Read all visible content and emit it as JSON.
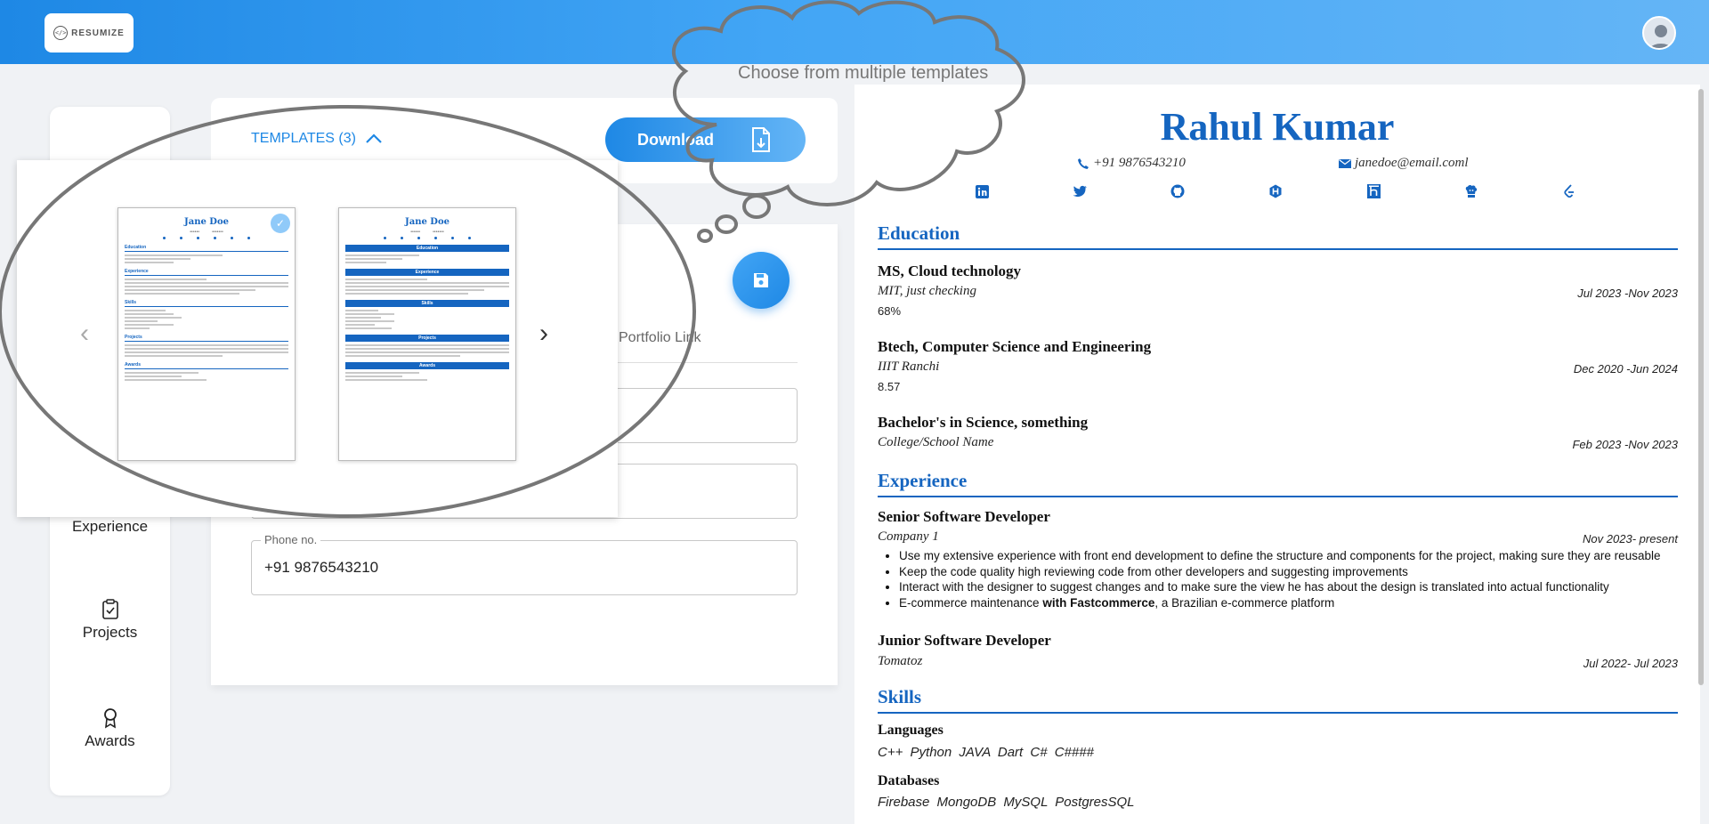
{
  "header": {
    "logo_text": "RESUMIZE",
    "logo_mark": "</>"
  },
  "sidebar": {
    "items": [
      {
        "label": "Experience",
        "icon": "briefcase-icon"
      },
      {
        "label": "Projects",
        "icon": "clipboard-check-icon"
      },
      {
        "label": "Awards",
        "icon": "award-icon"
      }
    ]
  },
  "toolbar": {
    "templates_label": "TEMPLATES (3)",
    "download_label": "Download"
  },
  "form": {
    "portfolio_tab": "Portfolio Link",
    "phone_label": "Phone no.",
    "phone_value": "+91 9876543210"
  },
  "template_popup": {
    "thumb1_name": "Jane Doe",
    "thumb2_name": "Jane Doe",
    "thumb1_sections": [
      "Education",
      "Experience",
      "Skills",
      "Projects",
      "Awards"
    ],
    "thumb2_sections": [
      "Education",
      "Experience",
      "Skills",
      "Projects",
      "Awards"
    ]
  },
  "annotation": {
    "bubble_text": "Choose from multiple templates"
  },
  "resume": {
    "name": "Rahul Kumar",
    "phone": "+91 9876543210",
    "email": "janedoe@email.coml",
    "socials": [
      "linkedin-icon",
      "twitter-icon",
      "github-icon",
      "hackerrank-icon",
      "hackerearth-icon",
      "codechef-icon",
      "leetcode-icon"
    ],
    "education_title": "Education",
    "education": [
      {
        "degree": "MS, Cloud technology",
        "school": "MIT, just checking",
        "dates": "Jul 2023 -Nov 2023",
        "score": "68%"
      },
      {
        "degree": "Btech, Computer Science and Engineering",
        "school": "IIIT Ranchi",
        "dates": "Dec 2020 -Jun 2024",
        "score": "8.57"
      },
      {
        "degree": "Bachelor's in Science, something",
        "school": "College/School Name",
        "dates": "Feb 2023 -Nov 2023",
        "score": ""
      }
    ],
    "experience_title": "Experience",
    "experience": [
      {
        "role": "Senior Software Developer",
        "company": "Company 1",
        "dates": "Nov 2023- present",
        "bullets": [
          "Use my extensive experience with front end development to define the structure and components for the project, making sure they are reusable",
          "Keep the code quality high reviewing code from other developers and suggesting improvements",
          "Interact with the designer to suggest changes and to make sure the view he has about the design is translated into actual functionality"
        ],
        "bullet4_pre": "E-commerce maintenance ",
        "bullet4_bold": "with Fastcommerce",
        "bullet4_post": ", a Brazilian e-commerce platform"
      },
      {
        "role": "Junior Software Developer",
        "company": "Tomatoz",
        "dates": "Jul 2022- Jul 2023"
      }
    ],
    "skills_title": "Skills",
    "skills": [
      {
        "head": "Languages",
        "list": "C++ Python JAVA Dart C# C####"
      },
      {
        "head": "Databases",
        "list": "Firebase MongoDB MySQL PostgresSQL"
      }
    ]
  }
}
